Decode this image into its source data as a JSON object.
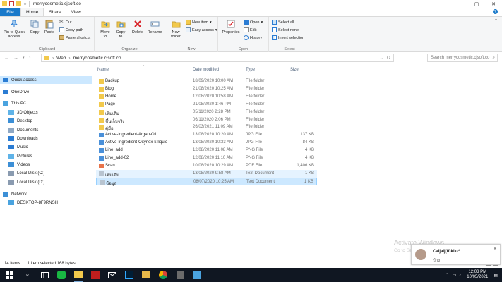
{
  "window": {
    "title": "merrycosmetic.cjsoft.co",
    "controls": [
      "–",
      "▢",
      "✕"
    ]
  },
  "tabs": [
    "File",
    "Home",
    "Share",
    "View"
  ],
  "ribbon": {
    "clipboard": {
      "label": "Clipboard",
      "pin": "Pin to Quick access",
      "copy": "Copy",
      "paste": "Paste",
      "cut": "Cut",
      "copy_path": "Copy path",
      "paste_shortcut": "Paste shortcut"
    },
    "organize": {
      "label": "Organize",
      "move_to": "Move to",
      "copy_to": "Copy to",
      "delete": "Delete",
      "rename": "Rename"
    },
    "new": {
      "label": "New",
      "new_folder": "New folder",
      "new_item": "New item",
      "easy_access": "Easy access"
    },
    "open": {
      "label": "Open",
      "properties": "Properties",
      "open": "Open",
      "edit": "Edit",
      "history": "History"
    },
    "select": {
      "label": "Select",
      "select_all": "Select all",
      "select_none": "Select none",
      "invert": "Invert selection"
    }
  },
  "address": {
    "path": [
      "Web",
      "merrycosmetic.cjsoft.co"
    ],
    "search_placeholder": "Search merrycosmetic.cjsoft.co"
  },
  "nav": [
    {
      "label": "Quick access",
      "icon": "star-icon",
      "color": "#2b7cd3"
    },
    {
      "label": "OneDrive",
      "icon": "cloud-icon",
      "color": "#2b7cd3"
    },
    {
      "label": "This PC",
      "icon": "computer-icon",
      "color": "#4aa3df"
    },
    {
      "label": "3D Objects",
      "icon": "cube-icon",
      "color": "#5fb3e8"
    },
    {
      "label": "Desktop",
      "icon": "desktop-icon",
      "color": "#3c8fd6"
    },
    {
      "label": "Documents",
      "icon": "documents-icon",
      "color": "#8fa8c4"
    },
    {
      "label": "Downloads",
      "icon": "download-icon",
      "color": "#2b7cd3"
    },
    {
      "label": "Music",
      "icon": "music-icon",
      "color": "#2b7cd3"
    },
    {
      "label": "Pictures",
      "icon": "pictures-icon",
      "color": "#5fb3e8"
    },
    {
      "label": "Videos",
      "icon": "videos-icon",
      "color": "#3c8fd6"
    },
    {
      "label": "Local Disk (C:)",
      "icon": "drive-icon",
      "color": "#8a9bb0"
    },
    {
      "label": "Local Disk (D:)",
      "icon": "drive-icon",
      "color": "#8a9bb0"
    },
    {
      "label": "Network",
      "icon": "network-icon",
      "color": "#3c8fd6"
    },
    {
      "label": "DESKTOP-8F9RNSH",
      "icon": "computer-icon",
      "color": "#4aa3df"
    }
  ],
  "columns": {
    "name": "Name",
    "date": "Date modified",
    "type": "Type",
    "size": "Size"
  },
  "files": [
    {
      "name": "Backup",
      "date": "18/09/2020 10:00 AM",
      "type": "File folder",
      "size": "",
      "icon": "folder-icon",
      "color": "#f2c94c"
    },
    {
      "name": "Blog",
      "date": "21/08/2020 10:25 AM",
      "type": "File folder",
      "size": "",
      "icon": "folder-icon",
      "color": "#f2c94c"
    },
    {
      "name": "Home",
      "date": "12/08/2020 10:58 AM",
      "type": "File folder",
      "size": "",
      "icon": "folder-icon",
      "color": "#f2c94c"
    },
    {
      "name": "Page",
      "date": "21/08/2020 1:46 PM",
      "type": "File folder",
      "size": "",
      "icon": "folder-icon",
      "color": "#f2c94c"
    },
    {
      "name": "เพิ่มเติม",
      "date": "05/11/2020 2:28 PM",
      "type": "File folder",
      "size": "",
      "icon": "folder-icon",
      "color": "#f2c94c"
    },
    {
      "name": "ขึ้นเก็บจริง",
      "date": "06/11/2020 2:06 PM",
      "type": "File folder",
      "size": "",
      "icon": "folder-icon",
      "color": "#f2c94c"
    },
    {
      "name": "คู่มือ",
      "date": "26/03/2021 11:09 AM",
      "type": "File folder",
      "size": "",
      "icon": "folder-icon",
      "color": "#f2c94c"
    },
    {
      "name": "Active-Ingredient-Argan-Oil",
      "date": "13/08/2020 10:20 AM",
      "type": "JPG File",
      "size": "137 KB",
      "icon": "image-file-icon",
      "color": "#4a90d9"
    },
    {
      "name": "Active-Ingredient-Oxynex-k-liquid",
      "date": "13/08/2020 10:33 AM",
      "type": "JPG File",
      "size": "84 KB",
      "icon": "image-file-icon",
      "color": "#4a90d9"
    },
    {
      "name": "Line_add",
      "date": "12/08/2020 11:08 AM",
      "type": "PNG File",
      "size": "4 KB",
      "icon": "image-file-icon",
      "color": "#4a90d9"
    },
    {
      "name": "Line_add-02",
      "date": "12/08/2020 11:10 AM",
      "type": "PNG File",
      "size": "4 KB",
      "icon": "image-file-icon",
      "color": "#4a90d9"
    },
    {
      "name": "Scan",
      "date": "10/08/2020 10:29 AM",
      "type": "PDF File",
      "size": "1,406 KB",
      "icon": "pdf-file-icon",
      "color": "#e8734a"
    },
    {
      "name": "เพิ่มเติม",
      "date": "13/08/2020 9:58 AM",
      "type": "Text Document",
      "size": "1 KB",
      "icon": "text-file-icon",
      "color": "#b8c4d0"
    },
    {
      "name": "ข้อมูล",
      "date": "08/07/2020 10:25 AM",
      "type": "Text Document",
      "size": "1 KB",
      "icon": "text-file-icon",
      "color": "#b8c4d0"
    }
  ],
  "status": {
    "count": "14 items",
    "selected": "1 item selected  168 bytes"
  },
  "watermark": {
    "line1": "Activate Windows",
    "line2": "Go to Settings to activate Windows."
  },
  "notification": {
    "name": "Caljalj(ff-kik-*",
    "message": "บ้าง"
  },
  "taskbar": {
    "time": "12:03 PM",
    "date": "10/05/2021"
  }
}
